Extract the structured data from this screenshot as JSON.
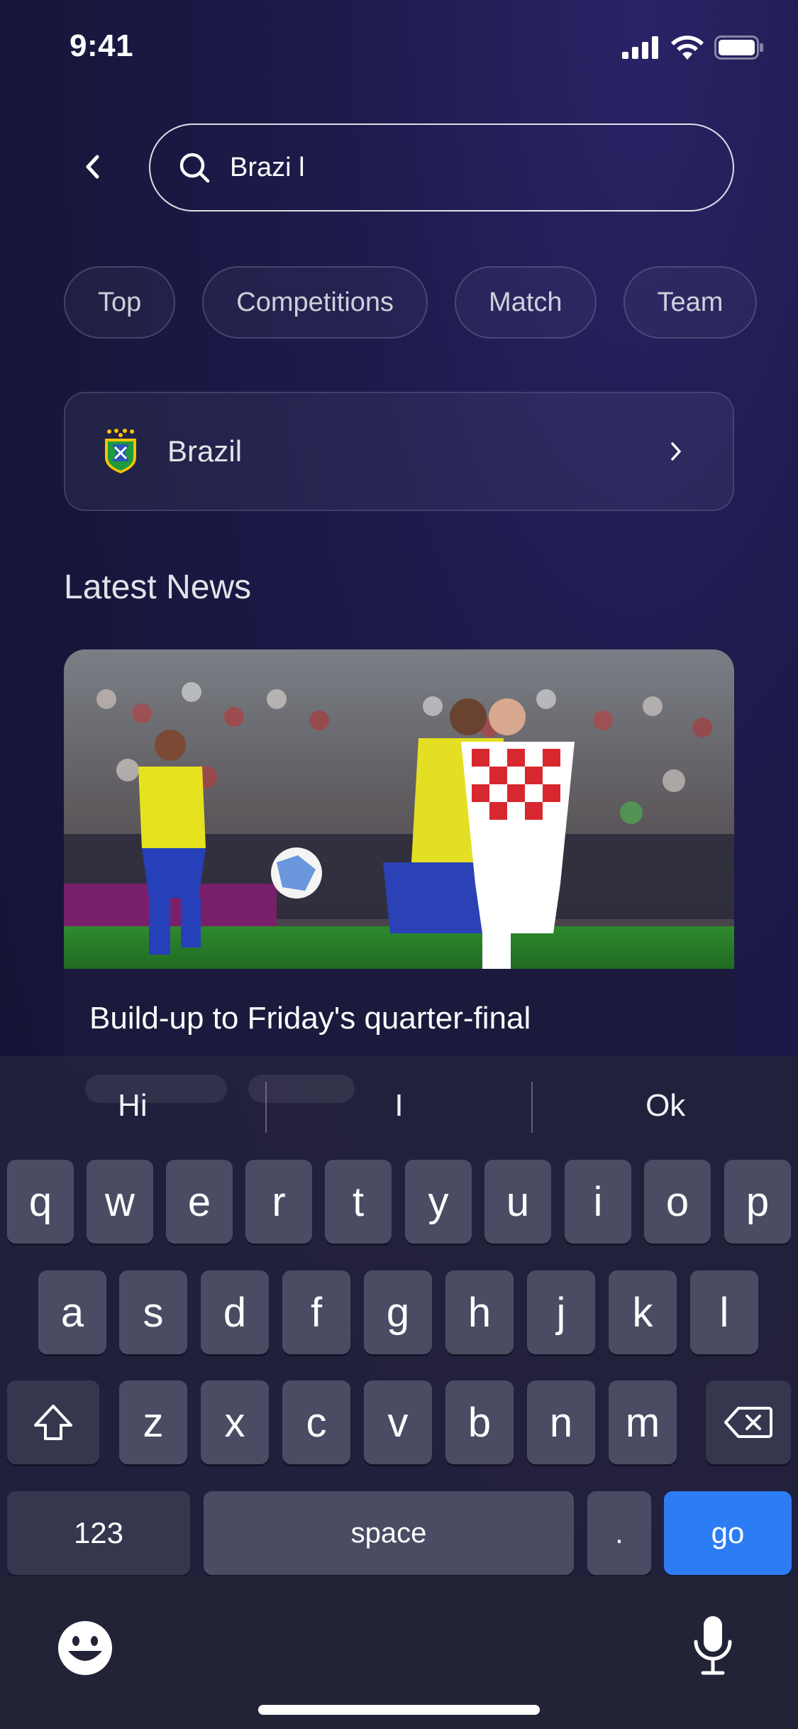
{
  "status_bar": {
    "time": "9:41"
  },
  "search": {
    "value": "Brazi l"
  },
  "chips": [
    {
      "label": "Top"
    },
    {
      "label": "Competitions"
    },
    {
      "label": "Match"
    },
    {
      "label": "Team"
    }
  ],
  "result": {
    "label": "Brazil"
  },
  "news": {
    "section_title": "Latest News",
    "items": [
      {
        "title": "Build-up to Friday's quarter-final"
      }
    ]
  },
  "keyboard": {
    "suggestions": [
      "Hi",
      "I",
      "Ok"
    ],
    "row1": [
      "q",
      "w",
      "e",
      "r",
      "t",
      "y",
      "u",
      "i",
      "o",
      "p"
    ],
    "row2": [
      "a",
      "s",
      "d",
      "f",
      "g",
      "h",
      "j",
      "k",
      "l"
    ],
    "row3": [
      "z",
      "x",
      "c",
      "v",
      "b",
      "n",
      "m"
    ],
    "numbers_label": "123",
    "space_label": "space",
    "period_label": ".",
    "go_label": "go"
  },
  "colors": {
    "accent": "#2c7cf4",
    "background": "#1d1a4a"
  }
}
